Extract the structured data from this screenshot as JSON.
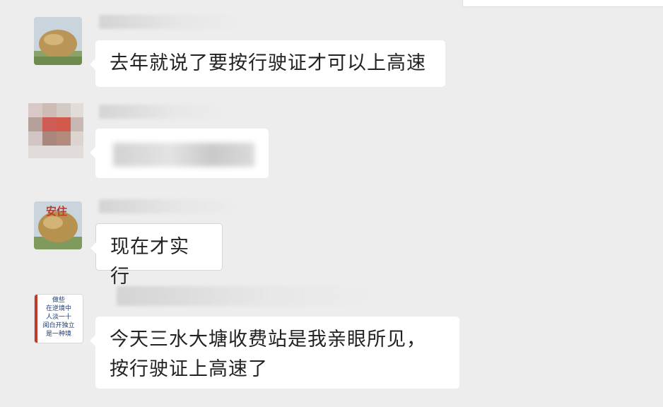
{
  "messages": [
    {
      "sender": "",
      "text": "去年就说了要按行驶证才可以上高速"
    },
    {
      "sender": "",
      "text": ""
    },
    {
      "sender": "",
      "text": "现在才实行"
    },
    {
      "sender": "",
      "text": "今天三水大塘收费站是我亲眼所见，按行驶证上高速了"
    }
  ],
  "avatars": [
    {
      "icon": "stone-avatar-icon",
      "caption": ""
    },
    {
      "icon": "pixelated-avatar-icon",
      "caption": ""
    },
    {
      "icon": "stone-avatar-icon",
      "caption": "安住"
    },
    {
      "icon": "calligraphy-avatar-icon",
      "lines": [
        "做些",
        "在逆境中",
        "人淡一十",
        "阅白开独立",
        "是一种境"
      ]
    }
  ],
  "colors": {
    "background": "#ededed",
    "bubble": "#ffffff",
    "text": "#222222"
  }
}
